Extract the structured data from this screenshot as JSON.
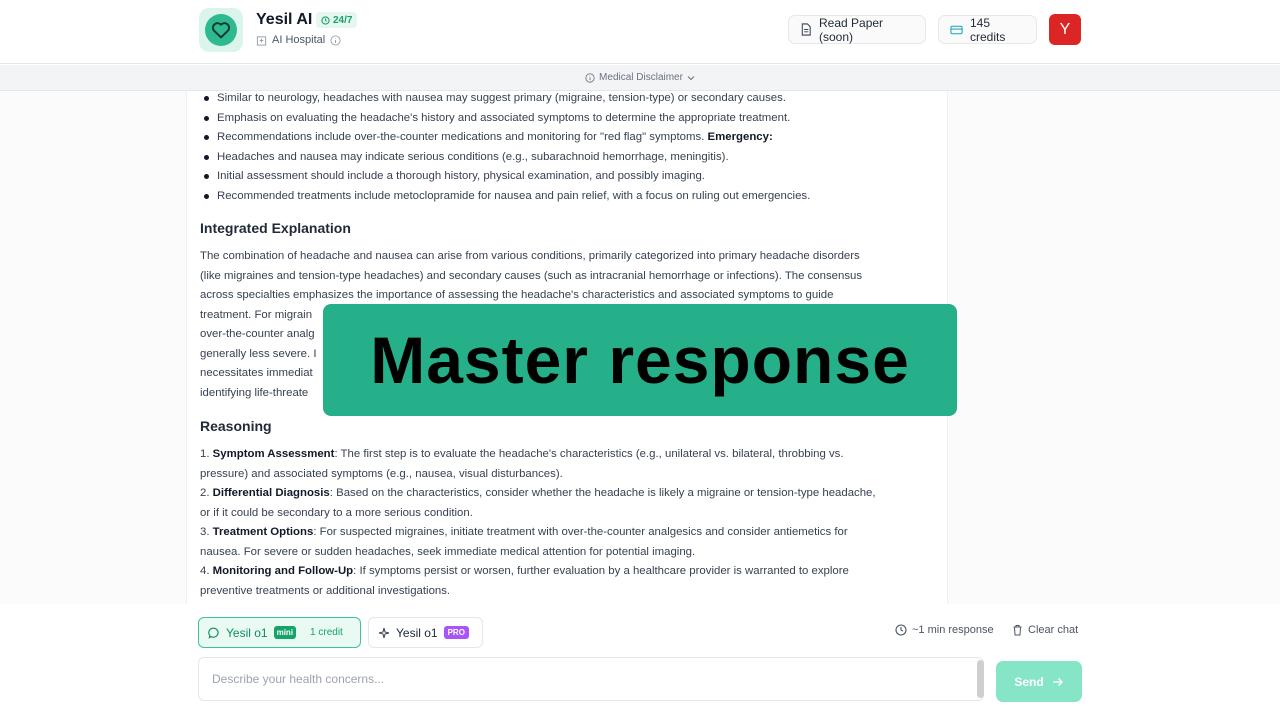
{
  "header": {
    "brand_title": "Yesil AI",
    "badge": "24/7",
    "subtitle": "AI Hospital",
    "read_paper_label": "Read Paper (soon)",
    "credits_label": "145 credits",
    "avatar_letter": "Y",
    "icons": {
      "logo": "heart-icon",
      "badge": "clock-icon",
      "subtitle": "hospital-icon",
      "info": "info-icon",
      "read": "document-icon",
      "credits": "card-icon"
    }
  },
  "disclaimer": {
    "label": "Medical Disclaimer"
  },
  "content": {
    "bullets": [
      {
        "text": "Similar to neurology, headaches with nausea may suggest primary (migraine, tension-type) or secondary causes."
      },
      {
        "text": "Emphasis on evaluating the headache's history and associated symptoms to determine the appropriate treatment."
      },
      {
        "text": "Recommendations include over-the-counter medications and monitoring for \"red flag\" symptoms. ",
        "bold": "Emergency:"
      },
      {
        "text": "Headaches and nausea may indicate serious conditions (e.g., subarachnoid hemorrhage, meningitis)."
      },
      {
        "text": "Initial assessment should include a thorough history, physical examination, and possibly imaging."
      },
      {
        "text": "Recommended treatments include metoclopramide for nausea and pain relief, with a focus on ruling out emergencies."
      }
    ],
    "integrated_heading": "Integrated Explanation",
    "integrated_lines": [
      "The combination of headache and nausea can arise from various conditions, primarily categorized into primary headache disorders",
      "(like migraines and tension-type headaches) and secondary causes (such as intracranial hemorrhage or infections). The consensus",
      "across specialties emphasizes the importance of assessing the headache's characteristics and associated symptoms to guide",
      "treatment. For migrain",
      "over-the-counter analg",
      "generally less severe. I",
      "necessitates immediat",
      "identifying life-threate"
    ],
    "reasoning_heading": "Reasoning",
    "reasoning_items": [
      {
        "num": "1.",
        "bold": "Symptom Assessment",
        "text": ": The first step is to evaluate the headache's characteristics (e.g., unilateral vs. bilateral, throbbing vs.",
        "cont": "pressure) and associated symptoms (e.g., nausea, visual disturbances)."
      },
      {
        "num": "2.",
        "bold": "Differential Diagnosis",
        "text": ": Based on the characteristics, consider whether the headache is likely a migraine or tension-type headache,",
        "cont": "or if it could be secondary to a more serious condition."
      },
      {
        "num": "3.",
        "bold": "Treatment Options",
        "text": ": For suspected migraines, initiate treatment with over-the-counter analgesics and consider antiemetics for",
        "cont": "nausea. For severe or sudden headaches, seek immediate medical attention for potential imaging."
      },
      {
        "num": "4.",
        "bold": "Monitoring and Follow-Up",
        "text": ": If symptoms persist or worsen, further evaluation by a healthcare provider is warranted to explore",
        "cont": "preventive treatments or additional investigations."
      }
    ]
  },
  "overlay": {
    "caption": "Master response"
  },
  "footer": {
    "model_mini": {
      "label": "Yesil o1",
      "tag": "mini",
      "credit": "1 credit"
    },
    "model_pro": {
      "label": "Yesil o1",
      "tag": "PRO"
    },
    "response_time": "~1 min response",
    "clear_chat": "Clear chat",
    "input_placeholder": "Describe your health concerns...",
    "send_label": "Send",
    "colors": {
      "accent": "#26b08a",
      "pro": "#a855f7"
    }
  }
}
